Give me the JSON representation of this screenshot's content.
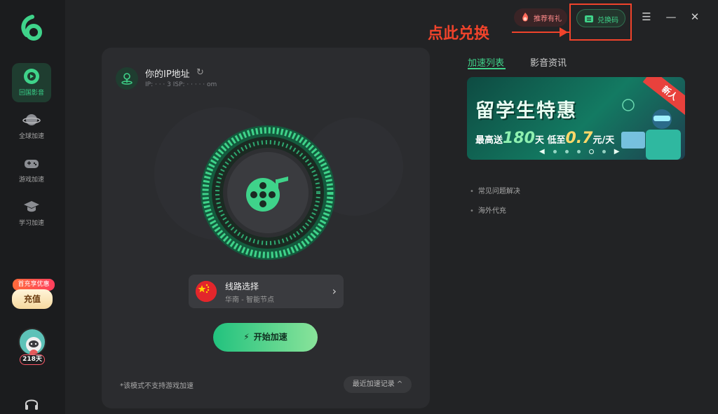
{
  "sidebar": {
    "items": [
      {
        "label": "回国影音",
        "icon": "music-play-icon",
        "active": true
      },
      {
        "label": "全球加速",
        "icon": "planet-icon",
        "active": false
      },
      {
        "label": "游戏加速",
        "icon": "gamepad-icon",
        "active": false
      },
      {
        "label": "学习加速",
        "icon": "graduation-cap-icon",
        "active": false
      }
    ],
    "promo_tag": "首充享优惠",
    "recharge_label": "充值",
    "days_badge": "218天"
  },
  "header": {
    "recommend_label": "推荐有礼",
    "redeem_label": "兑换码",
    "annotation": "点此兑换",
    "menu_glyph": "☰",
    "minimize_glyph": "—",
    "close_glyph": "✕"
  },
  "main": {
    "ip_title": "你的IP地址",
    "ip_line": "IP: ·   ·   ·  3    ISP: ·  ·  ·  ·  ·  om",
    "route_title": "线路选择",
    "route_sub": "华南 - 智能节点",
    "start_label": "开始加速",
    "note": "*该模式不支持游戏加速",
    "history_label": "最近加速记录 ^"
  },
  "right": {
    "tabs": [
      {
        "label": "加速列表",
        "active": true
      },
      {
        "label": "影音资讯",
        "active": false
      }
    ],
    "banner": {
      "title": "留学生特惠",
      "sub_prefix": "最高送",
      "sub_days": "180",
      "sub_mid": "天  低至",
      "sub_price": "0.7",
      "sub_suffix": "元/天",
      "ribbon": "新人"
    },
    "links": [
      "常见问题解决",
      "海外代充"
    ]
  },
  "colors": {
    "accent": "#3fd38a",
    "annotation_red": "#f0432b",
    "background": "#222325"
  }
}
